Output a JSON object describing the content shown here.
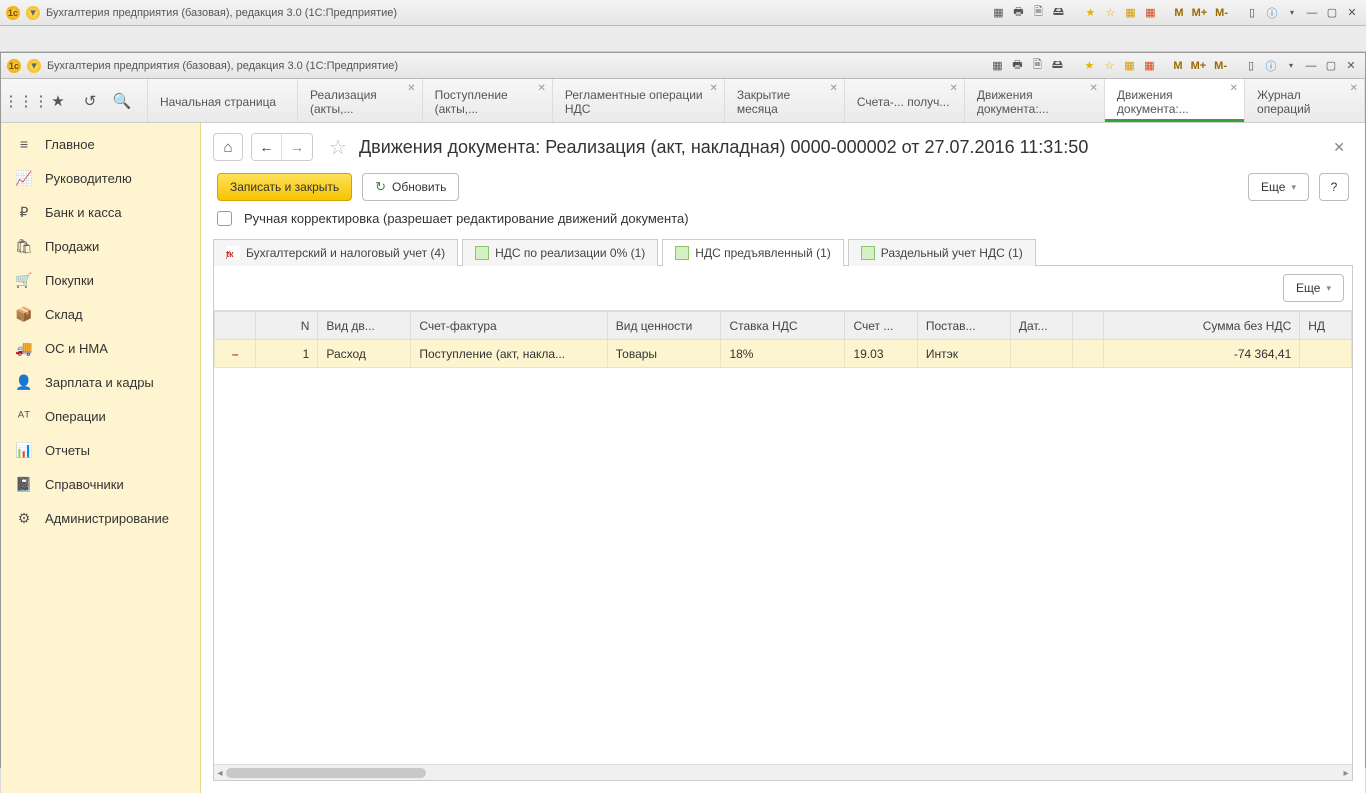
{
  "titlebar1": {
    "text": "Бухгалтерия предприятия (базовая), редакция 3.0  (1С:Предприятие)"
  },
  "titlebar2": {
    "text": "Бухгалтерия предприятия (базовая), редакция 3.0  (1С:Предприятие)"
  },
  "m_labels": {
    "m": "M",
    "mplus": "M+",
    "mminus": "M-"
  },
  "top_tabs": [
    {
      "label": "Начальная страница",
      "closable": false
    },
    {
      "label": "Реализация (акты,...",
      "closable": true
    },
    {
      "label": "Поступление (акты,...",
      "closable": true
    },
    {
      "label": "Регламентные операции НДС",
      "closable": true
    },
    {
      "label": "Закрытие месяца",
      "closable": true
    },
    {
      "label": "Счета-... получ...",
      "closable": true
    },
    {
      "label": "Движения документа:...",
      "closable": true
    },
    {
      "label": "Движения документа:...",
      "closable": true,
      "active": true
    },
    {
      "label": "Журнал операций",
      "closable": true
    }
  ],
  "sidebar": {
    "items": [
      {
        "icon": "≡",
        "label": "Главное"
      },
      {
        "icon": "📈",
        "label": "Руководителю"
      },
      {
        "icon": "₽",
        "label": "Банк и касса"
      },
      {
        "icon": "🛍",
        "label": "Продажи"
      },
      {
        "icon": "🛒",
        "label": "Покупки"
      },
      {
        "icon": "📦",
        "label": "Склад"
      },
      {
        "icon": "🚚",
        "label": "ОС и НМА"
      },
      {
        "icon": "👤",
        "label": "Зарплата и кадры"
      },
      {
        "icon": "ᴬᵀ",
        "label": "Операции"
      },
      {
        "icon": "📊",
        "label": "Отчеты"
      },
      {
        "icon": "📓",
        "label": "Справочники"
      },
      {
        "icon": "⚙",
        "label": "Администрирование"
      }
    ]
  },
  "document": {
    "title": "Движения документа: Реализация (акт, накладная) 0000-000002 от 27.07.2016 11:31:50",
    "save_close": "Записать и закрыть",
    "refresh": "Обновить",
    "more": "Еще",
    "help": "?",
    "manual_checkbox_label": "Ручная корректировка (разрешает редактирование движений документа)"
  },
  "subtabs": [
    {
      "label": "Бухгалтерский и налоговый учет (4)",
      "active": false,
      "icon": "red"
    },
    {
      "label": "НДС по реализации 0% (1)",
      "active": false,
      "icon": "green"
    },
    {
      "label": "НДС предъявленный (1)",
      "active": true,
      "icon": "green"
    },
    {
      "label": "Раздельный учет НДС (1)",
      "active": false,
      "icon": "green"
    }
  ],
  "grid": {
    "more": "Еще",
    "columns": [
      "",
      "N",
      "Вид дв...",
      "Счет-фактура",
      "Вид ценности",
      "Ставка НДС",
      "Счет ...",
      "Постав...",
      "Дат...",
      "",
      "Сумма без НДС",
      "НД"
    ],
    "rows": [
      {
        "icon": "–",
        "n": "1",
        "movement": "Расход",
        "invoice": "Поступление (акт, накла...",
        "value_type": "Товары",
        "vat_rate": "18%",
        "account": "19.03",
        "supplier": "Интэк",
        "date": "",
        "blank": "",
        "sum_no_vat": "-74 364,41",
        "vat": ""
      }
    ]
  }
}
